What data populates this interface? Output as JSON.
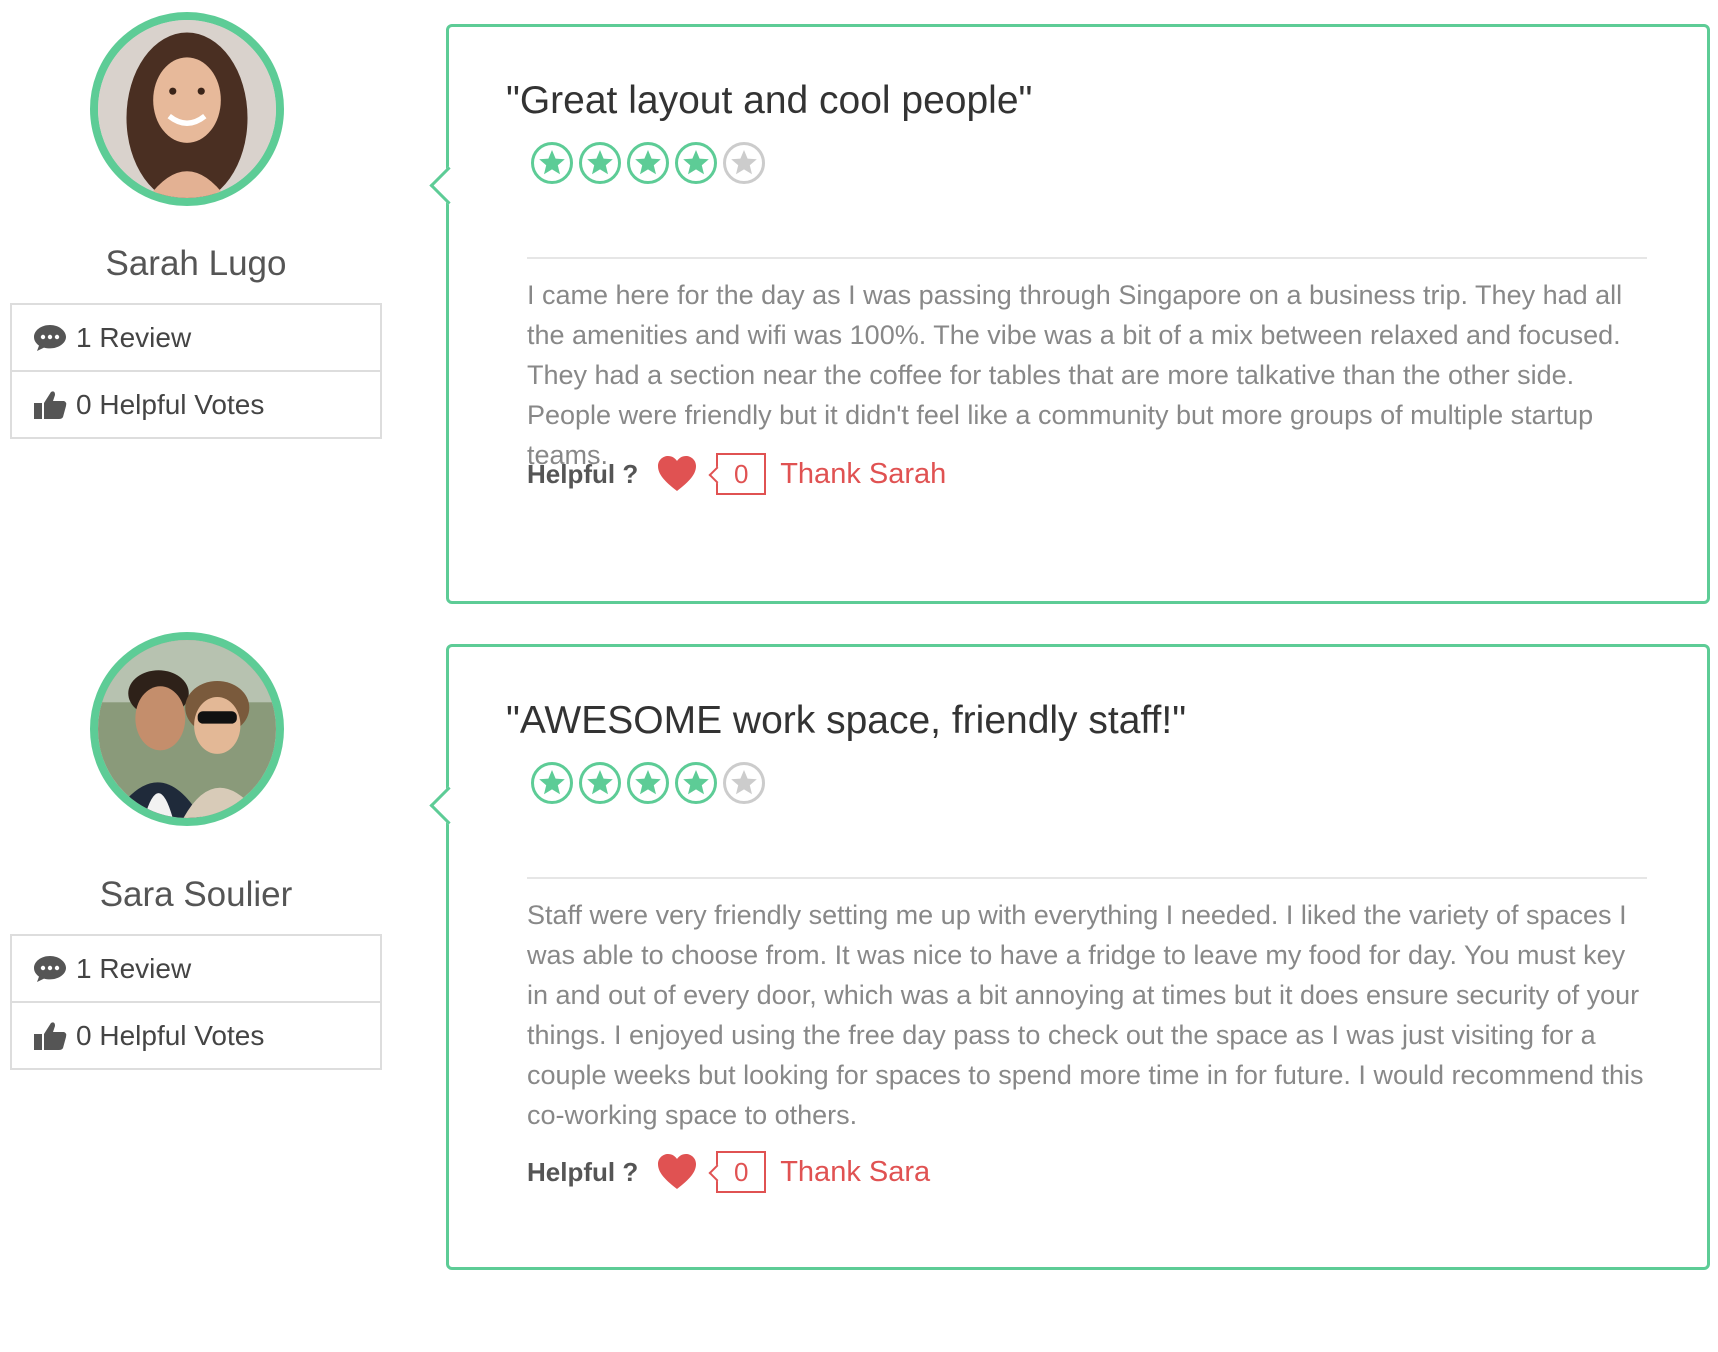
{
  "colors": {
    "accent": "#5dcc96",
    "thank": "#e05252",
    "star_empty": "#cccccc"
  },
  "reviews": [
    {
      "reviewer": {
        "name": "Sarah Lugo",
        "review_count": "1 Review",
        "helpful_votes": "0 Helpful Votes",
        "avatar": "profile-photo-woman"
      },
      "title": "\"Great layout and cool people\"",
      "rating": 4,
      "rating_max": 5,
      "body": "I came here for the day as I was passing through Singapore on a business trip. They had all the amenities and wifi was 100%. The vibe was a bit of a mix between relaxed and focused. They had a section near the coffee for tables that are more talkative than the other side. People were friendly but it didn't feel like a community but more groups of multiple startup teams.",
      "helpful_label": "Helpful ?",
      "helpful_count": "0",
      "thank_label": "Thank Sarah"
    },
    {
      "reviewer": {
        "name": "Sara Soulier",
        "review_count": "1 Review",
        "helpful_votes": "0 Helpful Votes",
        "avatar": "profile-photo-couple"
      },
      "title": "\"AWESOME work space, friendly staff!\"",
      "rating": 4,
      "rating_max": 5,
      "body": "Staff were very friendly setting me up with everything I needed. I liked the variety of spaces I was able to choose from. It was nice to have a fridge to leave my food for day. You must key in and out of every door, which was a bit annoying at times but it does ensure security of your things. I enjoyed using the free day pass to check out the space as I was just visiting for a couple weeks but looking for spaces to spend more time in for future. I would recommend this co-working space to others.",
      "helpful_label": "Helpful ?",
      "helpful_count": "0",
      "thank_label": "Thank Sara"
    }
  ]
}
